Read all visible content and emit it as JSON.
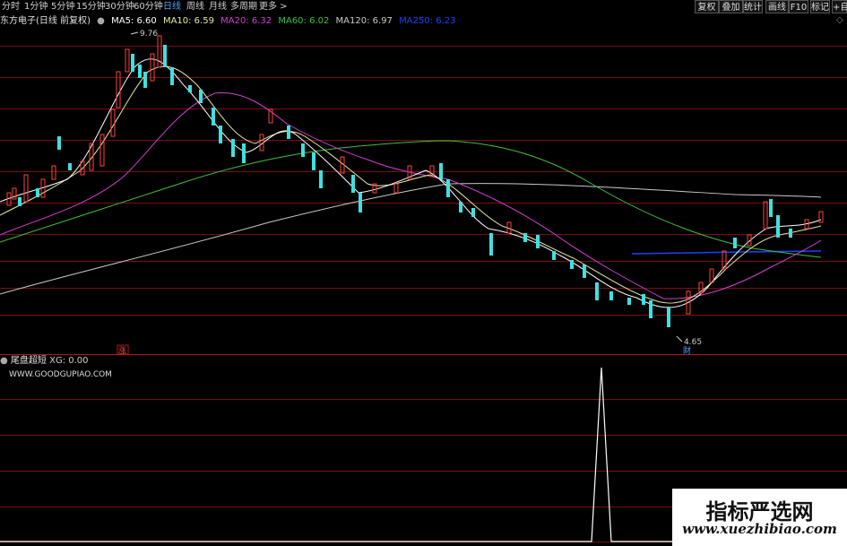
{
  "toolbar": {
    "timeframes": [
      "分时",
      "1分钟",
      "5分钟",
      "15分钟",
      "30分钟",
      "60分钟",
      "日线",
      "周线",
      "月线",
      "多周期",
      "更多 >"
    ],
    "active_timeframe": "日线",
    "buttons": [
      "复权",
      "叠加",
      "统计",
      "画线",
      "F10",
      "标记",
      "+自"
    ]
  },
  "main_chart": {
    "stock_title": "东方电子(日线 前复权)",
    "ma_legend": [
      {
        "label": "MA5: 6.60",
        "color": "#ffffff"
      },
      {
        "label": "MA10: 6.59",
        "color": "#e8e8a0"
      },
      {
        "label": "MA20: 6.32",
        "color": "#d040d0"
      },
      {
        "label": "MA60: 6.02",
        "color": "#40c040"
      },
      {
        "label": "MA120: 6.97",
        "color": "#c8c8c8"
      },
      {
        "label": "MA250: 6.23",
        "color": "#2040ff"
      }
    ],
    "high_label": "9.76",
    "low_label": "4.65",
    "marker_up": "涨",
    "marker_cai": "财"
  },
  "indicator": {
    "title": "尾盘超短",
    "xg_label": "XG: 0.00",
    "site": "WWW.GOODGUPIAO.COM"
  },
  "watermark": {
    "title": "指标严选网",
    "url": "www.xuezhibiao.com"
  },
  "colors": {
    "up": "#ff4040",
    "down": "#40e0e0",
    "grid": "#7a1010"
  }
}
